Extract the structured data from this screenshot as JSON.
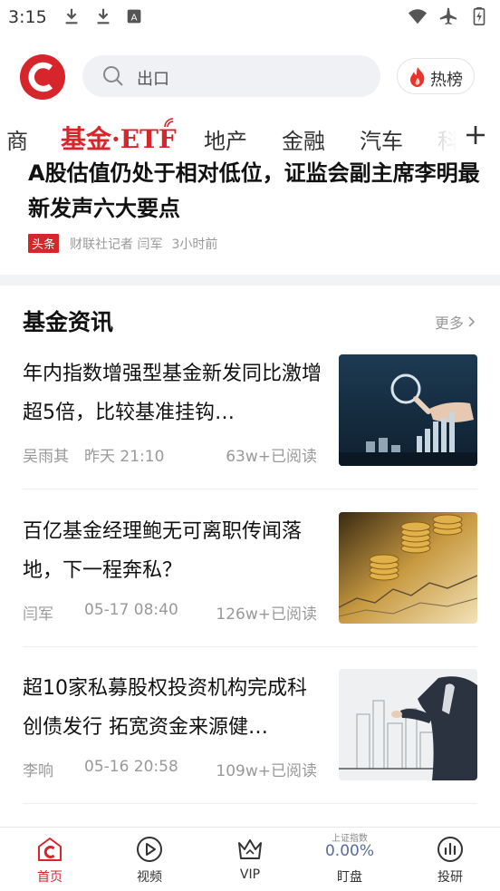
{
  "status_bar": {
    "time": "3:15",
    "left_icons": [
      "download-icon",
      "download-icon",
      "font-app-icon"
    ],
    "right_icons": [
      "wifi-icon",
      "airplane-icon",
      "battery-charging-icon"
    ]
  },
  "header": {
    "logo": "cls-logo-icon",
    "search_placeholder": "出口",
    "hot_label": "热榜"
  },
  "tabs": [
    {
      "label": "商",
      "active": false
    },
    {
      "label": "基金·ETF",
      "active": true
    },
    {
      "label": "地产",
      "active": false
    },
    {
      "label": "金融",
      "active": false
    },
    {
      "label": "汽车",
      "active": false
    },
    {
      "label": "科",
      "active": false
    }
  ],
  "headline": {
    "title": "A股估值仍处于相对低位，证监会副主席李明最新发声六大要点",
    "badge": "头条",
    "source": "财联社记者 闫军",
    "time": "3小时前"
  },
  "section": {
    "title": "基金资讯",
    "more": "更多"
  },
  "news": [
    {
      "title": "年内指数增强型基金新发同比激增超5倍，比较基准挂钩…",
      "author": "吴雨其",
      "time": "昨天 21:10",
      "reads": "63w+已阅读",
      "thumb": "magnifier-coins"
    },
    {
      "title": "百亿基金经理鲍无可离职传闻落地，下一程奔私？",
      "author": "闫军",
      "time": "05-17 08:40",
      "reads": "126w+已阅读",
      "thumb": "gold-coins"
    },
    {
      "title": "超10家私募股权投资机构完成科创债发行 拓宽资金来源健…",
      "author": "李响",
      "time": "05-16 20:58",
      "reads": "109w+已阅读",
      "thumb": "city-businessman"
    }
  ],
  "bottom_nav": [
    {
      "label": "首页",
      "icon": "home-c-icon",
      "active": true
    },
    {
      "label": "视频",
      "icon": "play-circle-icon",
      "active": false
    },
    {
      "label": "VIP",
      "icon": "crown-icon",
      "active": false
    },
    {
      "label": "盯盘",
      "index_label": "上证指数",
      "index_value": "0.00%",
      "active": false
    },
    {
      "label": "投研",
      "icon": "bar-chart-circle-icon",
      "active": false
    }
  ],
  "colors": {
    "brand_red": "#d6262b",
    "text_primary": "#111111",
    "text_muted": "#999999",
    "index_blue": "#5a6a9a"
  }
}
